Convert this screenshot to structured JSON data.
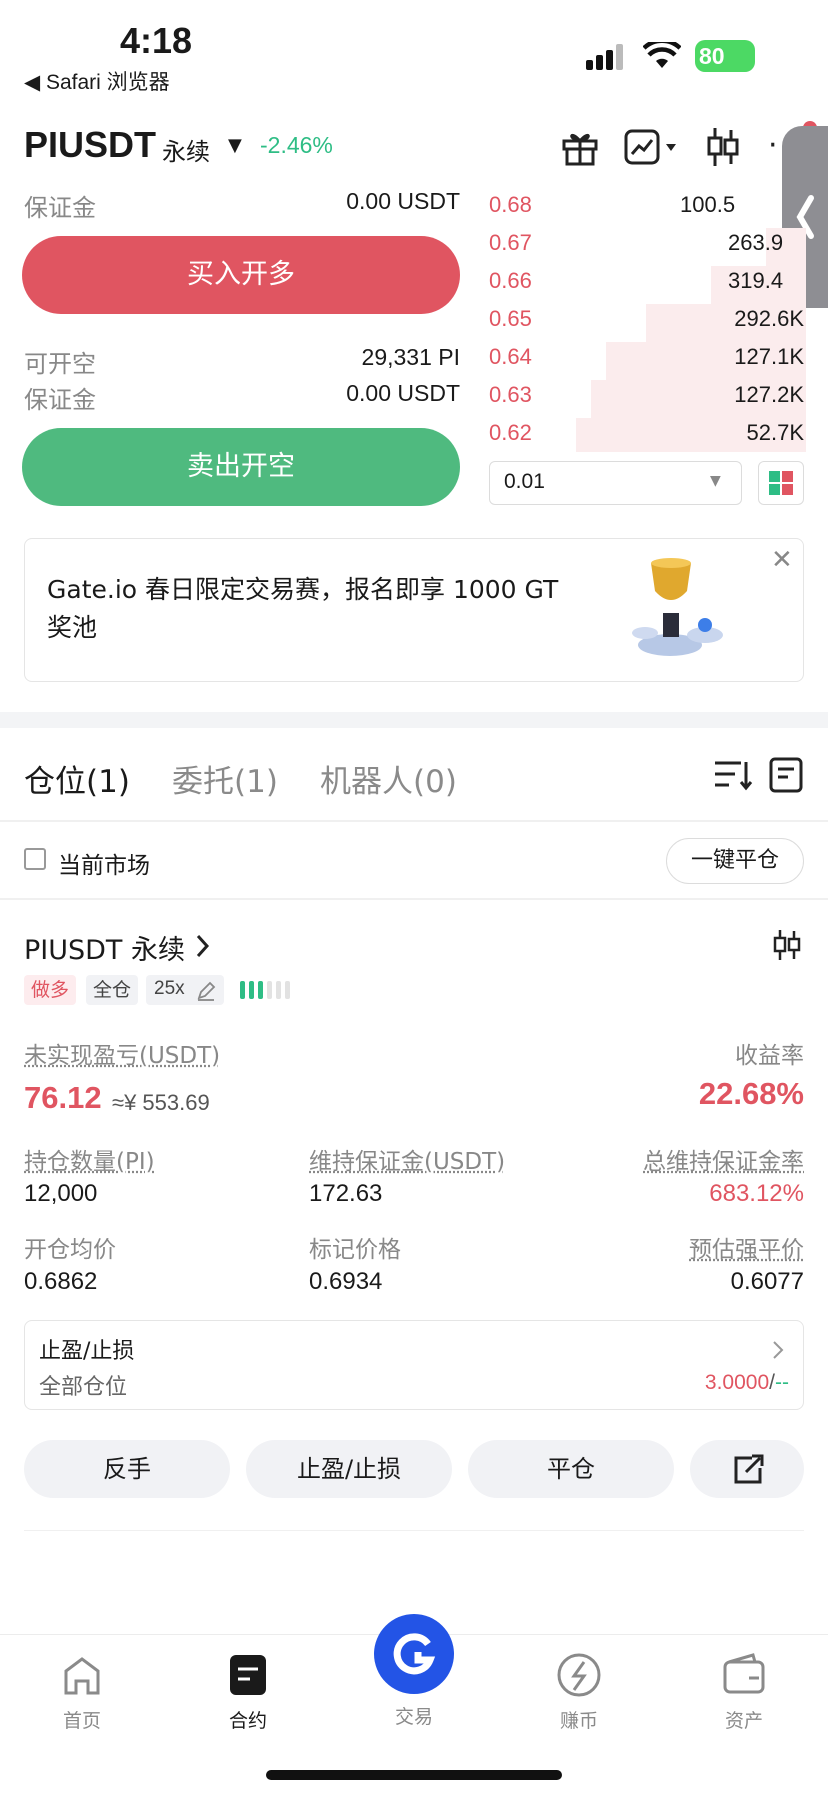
{
  "status_bar": {
    "time": "4:18",
    "back_label": "◀ Safari 浏览器",
    "battery": "80"
  },
  "header": {
    "symbol": "PIUSDT",
    "type": "永续",
    "change": "-2.46%"
  },
  "order_panel": {
    "long": {
      "margin_label": "保证金",
      "margin_value": "0.00 USDT",
      "button": "买入开多"
    },
    "short": {
      "available_label": "可开空",
      "available_value": "29,331 PI",
      "margin_label": "保证金",
      "margin_value": "0.00 USDT",
      "button": "卖出开空"
    }
  },
  "order_book": {
    "rows": [
      {
        "price": "0.68",
        "qty": "100.5"
      },
      {
        "price": "0.67",
        "qty": "263.9"
      },
      {
        "price": "0.66",
        "qty": "319.4"
      },
      {
        "price": "0.65",
        "qty": "292.6K"
      },
      {
        "price": "0.64",
        "qty": "127.1K"
      },
      {
        "price": "0.63",
        "qty": "127.2K"
      },
      {
        "price": "0.62",
        "qty": "52.7K"
      }
    ],
    "depth_select": "0.01"
  },
  "banner": {
    "text": "Gate.io 春日限定交易赛，报名即享 1000 GT 奖池"
  },
  "tabs": [
    {
      "label": "仓位(1)"
    },
    {
      "label": "委托(1)"
    },
    {
      "label": "机器人(0)"
    }
  ],
  "filter": {
    "checkbox_label": "当前市场",
    "close_all": "一键平仓"
  },
  "position": {
    "title": "PIUSDT 永续",
    "tags": {
      "side": "做多",
      "mode": "全仓",
      "leverage": "25x"
    },
    "pnl_label": "未实现盈亏(USDT)",
    "pnl_value": "76.12",
    "pnl_cny": "≈¥ 553.69",
    "roi_label": "收益率",
    "roi_value": "22.68%",
    "size_label": "持仓数量(PI)",
    "size_value": "12,000",
    "mm_label": "维持保证金(USDT)",
    "mm_value": "172.63",
    "mmr_label": "总维持保证金率",
    "mmr_value": "683.12%",
    "entry_label": "开仓均价",
    "entry_value": "0.6862",
    "mark_label": "标记价格",
    "mark_value": "0.6934",
    "liq_label": "预估强平价",
    "liq_value": "0.6077",
    "tpsl": {
      "title": "止盈/止损",
      "sub": "全部仓位",
      "tp_value": "3.0000",
      "sep": "/",
      "sl_value": "--"
    },
    "actions": {
      "reverse": "反手",
      "tpsl": "止盈/止损",
      "close": "平仓"
    }
  },
  "bottom_nav": [
    {
      "label": "首页"
    },
    {
      "label": "合约"
    },
    {
      "label": "交易"
    },
    {
      "label": "赚币"
    },
    {
      "label": "资产"
    }
  ],
  "colors": {
    "green": "#2ebd85",
    "red": "#e05561",
    "blue": "#2354e6"
  }
}
